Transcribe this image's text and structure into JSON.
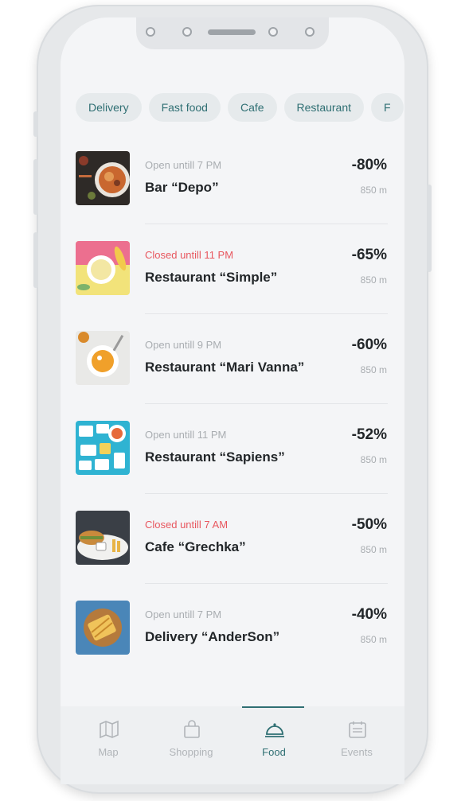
{
  "categories": [
    "Delivery",
    "Fast food",
    "Cafe",
    "Restaurant",
    "F"
  ],
  "places": [
    {
      "status": "Open untill 7 PM",
      "closed": false,
      "name": "Bar “Depo”",
      "discount": "-80%",
      "distance": "850 m"
    },
    {
      "status": "Closed untill 11 PM",
      "closed": true,
      "name": "Restaurant “Simple”",
      "discount": "-65%",
      "distance": "850 m"
    },
    {
      "status": "Open untill 9 PM",
      "closed": false,
      "name": "Restaurant “Mari Vanna”",
      "discount": "-60%",
      "distance": "850 m"
    },
    {
      "status": "Open untill 11 PM",
      "closed": false,
      "name": "Restaurant “Sapiens”",
      "discount": "-52%",
      "distance": "850 m"
    },
    {
      "status": "Closed untill 7 AM",
      "closed": true,
      "name": "Cafe “Grechka”",
      "discount": "-50%",
      "distance": "850 m"
    },
    {
      "status": "Open untill 7 PM",
      "closed": false,
      "name": "Delivery “AnderSon”",
      "discount": "-40%",
      "distance": "850 m"
    }
  ],
  "tabs": [
    {
      "label": "Map",
      "icon": "map-icon"
    },
    {
      "label": "Shopping",
      "icon": "shopping-bag-icon"
    },
    {
      "label": "Food",
      "icon": "food-cloche-icon",
      "active": true
    },
    {
      "label": "Events",
      "icon": "events-icon"
    }
  ],
  "colors": {
    "accent": "#2f6f73",
    "closed": "#e8575f",
    "muted": "#a9adb1"
  }
}
